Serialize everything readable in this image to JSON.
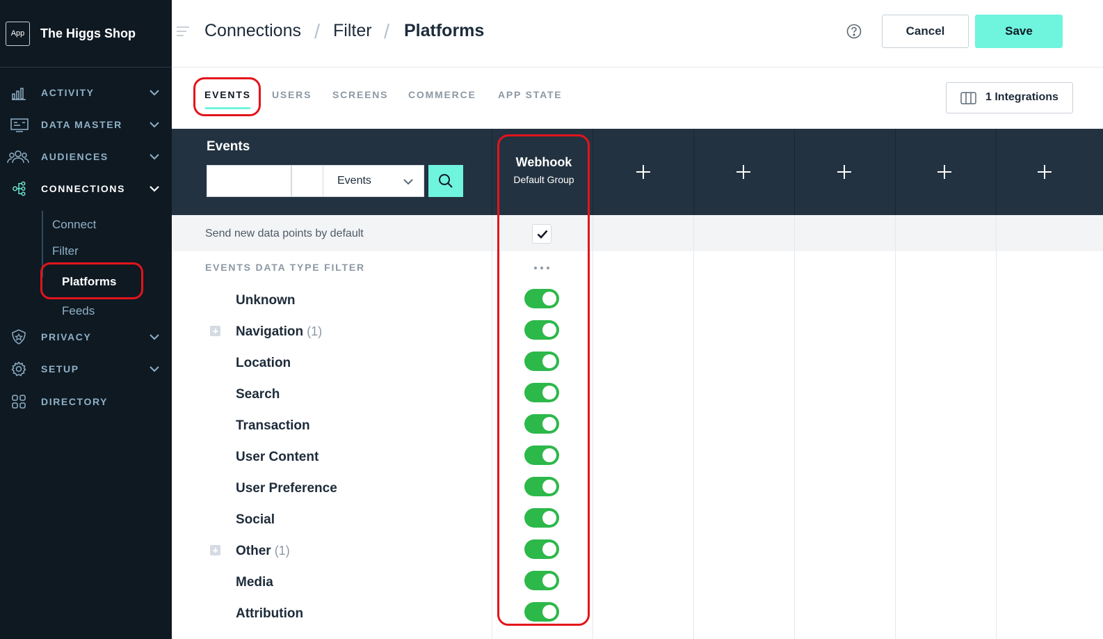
{
  "sidebar": {
    "app_badge": "App",
    "brand": "The Higgs Shop",
    "items": [
      {
        "label": "ACTIVITY",
        "icon": "bar-chart-icon"
      },
      {
        "label": "DATA MASTER",
        "icon": "data-master-icon"
      },
      {
        "label": "AUDIENCES",
        "icon": "people-icon"
      },
      {
        "label": "CONNECTIONS",
        "icon": "connections-icon"
      },
      {
        "label": "PRIVACY",
        "icon": "shield-icon"
      },
      {
        "label": "SETUP",
        "icon": "gear-icon"
      },
      {
        "label": "DIRECTORY",
        "icon": "grid-icon"
      }
    ],
    "subitems": [
      "Connect",
      "Filter",
      "Platforms",
      "Feeds"
    ]
  },
  "header": {
    "breadcrumb": [
      "Connections",
      "Filter",
      "Platforms"
    ],
    "separator": "/",
    "cancel_label": "Cancel",
    "save_label": "Save"
  },
  "tabs": [
    "EVENTS",
    "USERS",
    "SCREENS",
    "COMMERCE",
    "APP STATE"
  ],
  "integrations_label": "1 Integrations",
  "grid": {
    "title": "Events",
    "select_value": "Events",
    "webhook": {
      "name": "Webhook",
      "group": "Default Group"
    },
    "default_row_label": "Send new data points by default",
    "default_checked": true,
    "section_label": "EVENTS DATA TYPE FILTER",
    "events": [
      {
        "label": "Unknown",
        "count": "",
        "expandable": false,
        "enabled": true
      },
      {
        "label": "Navigation",
        "count": "(1)",
        "expandable": true,
        "enabled": true
      },
      {
        "label": "Location",
        "count": "",
        "expandable": false,
        "enabled": true
      },
      {
        "label": "Search",
        "count": "",
        "expandable": false,
        "enabled": true
      },
      {
        "label": "Transaction",
        "count": "",
        "expandable": false,
        "enabled": true
      },
      {
        "label": "User Content",
        "count": "",
        "expandable": false,
        "enabled": true
      },
      {
        "label": "User Preference",
        "count": "",
        "expandable": false,
        "enabled": true
      },
      {
        "label": "Social",
        "count": "",
        "expandable": false,
        "enabled": true
      },
      {
        "label": "Other",
        "count": "(1)",
        "expandable": true,
        "enabled": true
      },
      {
        "label": "Media",
        "count": "",
        "expandable": false,
        "enabled": true
      },
      {
        "label": "Attribution",
        "count": "",
        "expandable": false,
        "enabled": true
      }
    ]
  },
  "colors": {
    "sidebar_bg": "#0f1922",
    "accent": "#6ff4de",
    "toggle_on": "#2db84a",
    "band_bg": "#233240",
    "highlight": "#e3141b"
  }
}
